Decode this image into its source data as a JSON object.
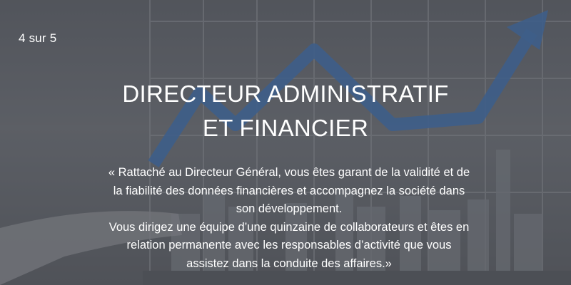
{
  "slide": {
    "counter": "4 sur 5",
    "title_line1": "DIRECTEUR ADMINISTRATIF",
    "title_line2": "ET FINANCIER",
    "body_lines": [
      "« Rattaché au Directeur Général, vous êtes garant de la validité et de",
      "la fiabilité des données financières et accompagnez la société dans",
      "son développement.",
      "Vous dirigez une équipe d’une quinzaine de collaborateurs et êtes en",
      "relation permanente avec les responsables d’activité que vous",
      "assistez dans la conduite des affaires.»"
    ]
  },
  "background": {
    "description_icon": "growth-chart-arrow-icon",
    "arrow_color": "#3f6fae"
  }
}
